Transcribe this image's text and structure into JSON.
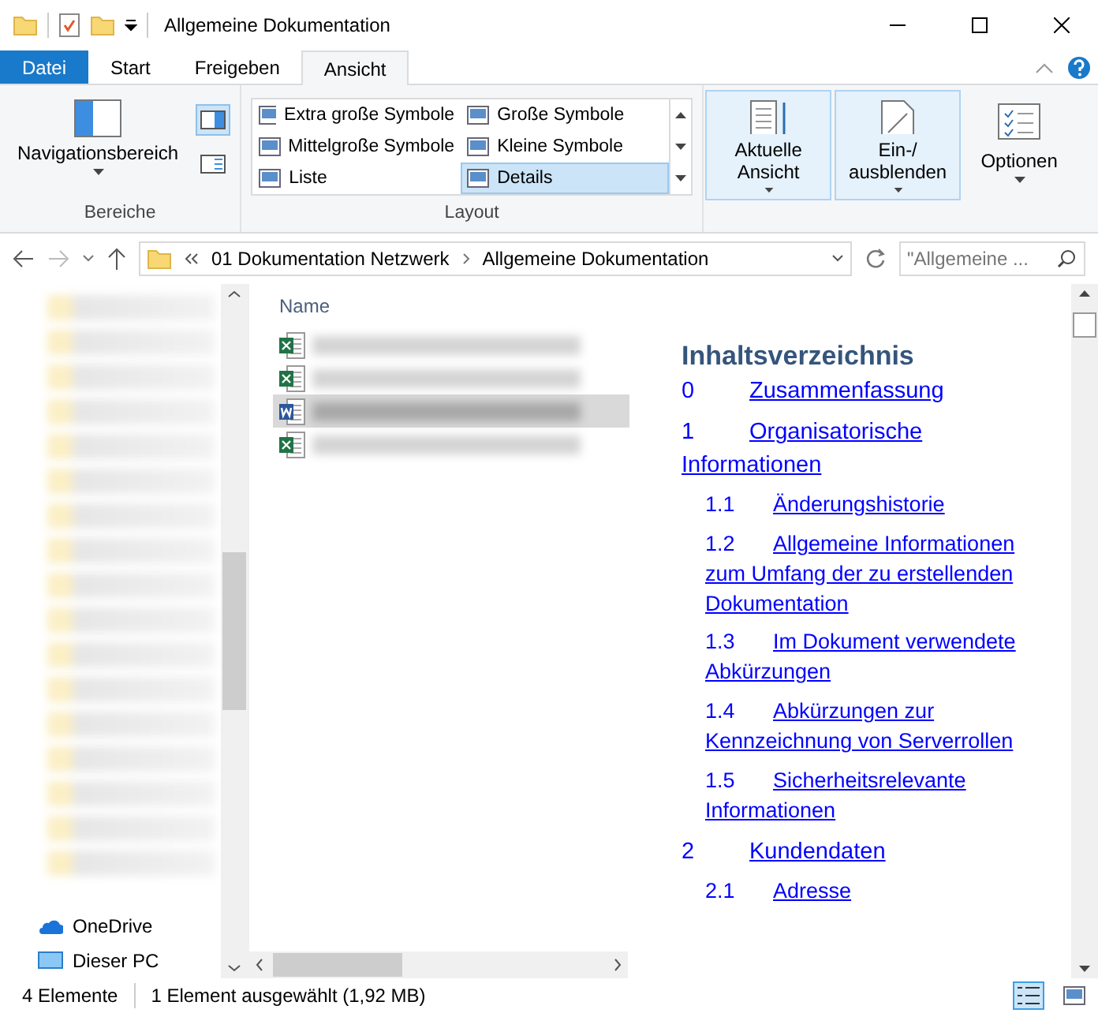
{
  "window": {
    "title": "Allgemeine Dokumentation"
  },
  "ribbon_tabs": [
    {
      "label": "Datei",
      "kind": "file",
      "selected": false
    },
    {
      "label": "Start",
      "kind": "tab",
      "selected": false
    },
    {
      "label": "Freigeben",
      "kind": "tab",
      "selected": false
    },
    {
      "label": "Ansicht",
      "kind": "tab",
      "selected": true
    }
  ],
  "ribbon": {
    "panes": {
      "button": "Navigationsbereich",
      "group": "Bereiche"
    },
    "layout": {
      "options": [
        {
          "label": "Extra große Symbole",
          "selected": false
        },
        {
          "label": "Große Symbole",
          "selected": false
        },
        {
          "label": "Mittelgroße Symbole",
          "selected": false
        },
        {
          "label": "Kleine Symbole",
          "selected": false
        },
        {
          "label": "Liste",
          "selected": false
        },
        {
          "label": "Details",
          "selected": true
        }
      ],
      "group": "Layout"
    },
    "buttons": [
      {
        "label": "Aktuelle Ansicht",
        "kind": "sort",
        "selected": true
      },
      {
        "label": "Ein-/ ausblenden",
        "kind": "toggle",
        "selected": true
      },
      {
        "label": "Optionen",
        "kind": "options",
        "selected": false
      }
    ]
  },
  "address": {
    "path": [
      "01 Dokumentation Netzwerk",
      "Allgemeine Dokumentation"
    ],
    "search_placeholder": "\"Allgemeine ..."
  },
  "navigation": {
    "items": [
      {
        "label": "OneDrive",
        "kind": "cloud"
      },
      {
        "label": "Dieser PC",
        "kind": "pc"
      }
    ]
  },
  "files": {
    "column": "Name",
    "rows": [
      {
        "kind": "excel",
        "selected": false
      },
      {
        "kind": "excel",
        "selected": false
      },
      {
        "kind": "word",
        "selected": true
      },
      {
        "kind": "excel",
        "selected": false
      }
    ]
  },
  "preview": {
    "heading": "Inhaltsverzeichnis",
    "toc": [
      {
        "number": "0",
        "title": "Zusammenfassung"
      },
      {
        "number": "1",
        "title": "Organisatorische Informationen",
        "children": [
          {
            "number": "1.1",
            "title": "Änderungshistorie"
          },
          {
            "number": "1.2",
            "title": "Allgemeine Informationen zum Umfang der zu erstellenden Dokumentation"
          },
          {
            "number": "1.3",
            "title": "Im Dokument verwendete Abkürzungen"
          },
          {
            "number": "1.4",
            "title": "Abkürzungen zur Kennzeichnung von Serverrollen"
          },
          {
            "number": "1.5",
            "title": "Sicherheitsrelevante Informationen"
          }
        ]
      },
      {
        "number": "2",
        "title": "Kundendaten",
        "children": [
          {
            "number": "2.1",
            "title": "Adresse"
          }
        ]
      }
    ]
  },
  "status_bar": {
    "count": "4 Elemente",
    "selection": "1 Element ausgewählt (1,92 MB)",
    "views": [
      {
        "kind": "details",
        "selected": true
      },
      {
        "kind": "tiles",
        "selected": false
      }
    ]
  }
}
